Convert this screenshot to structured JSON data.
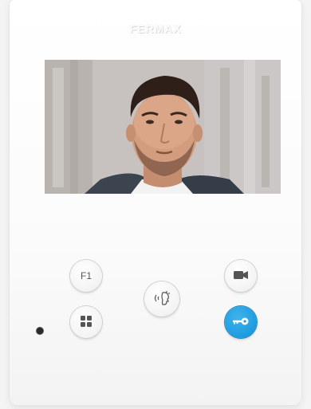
{
  "brand": {
    "name": "FERMAX"
  },
  "screen": {
    "content": "video-feed"
  },
  "buttons": {
    "f1_label": "F1",
    "menu_icon": "grid-icon",
    "talk_icon": "talk-icon",
    "camera_icon": "camera-icon",
    "key_icon": "key-icon"
  },
  "colors": {
    "device_body": "#ffffff",
    "key_button": "#1e9be0",
    "icon_gray": "#555555"
  }
}
